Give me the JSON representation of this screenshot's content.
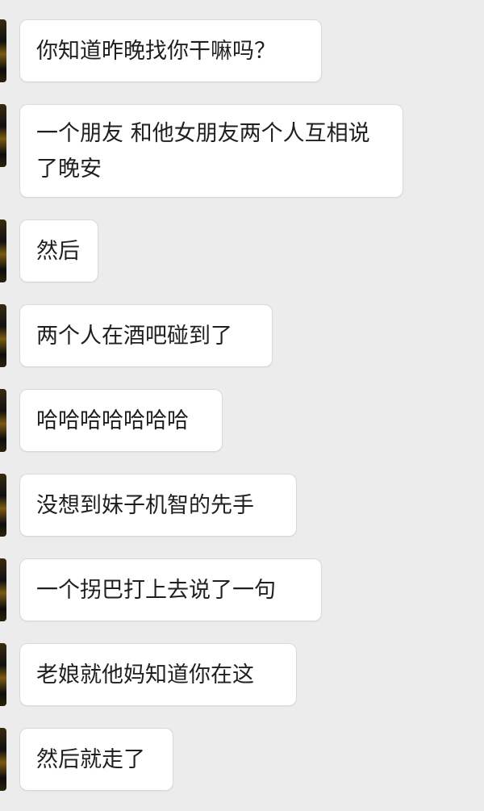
{
  "messages": [
    {
      "text": "你知道昨晚找你干嘛吗？"
    },
    {
      "text": "一个朋友 和他女朋友两个人互相说了晚安"
    },
    {
      "text": "然后"
    },
    {
      "text": "两个人在酒吧碰到了"
    },
    {
      "text": "哈哈哈哈哈哈哈"
    },
    {
      "text": "没想到妹子机智的先手"
    },
    {
      "text": "一个拐巴打上去说了一句"
    },
    {
      "text": "老娘就他妈知道你在这"
    },
    {
      "text": "然后就走了"
    }
  ]
}
